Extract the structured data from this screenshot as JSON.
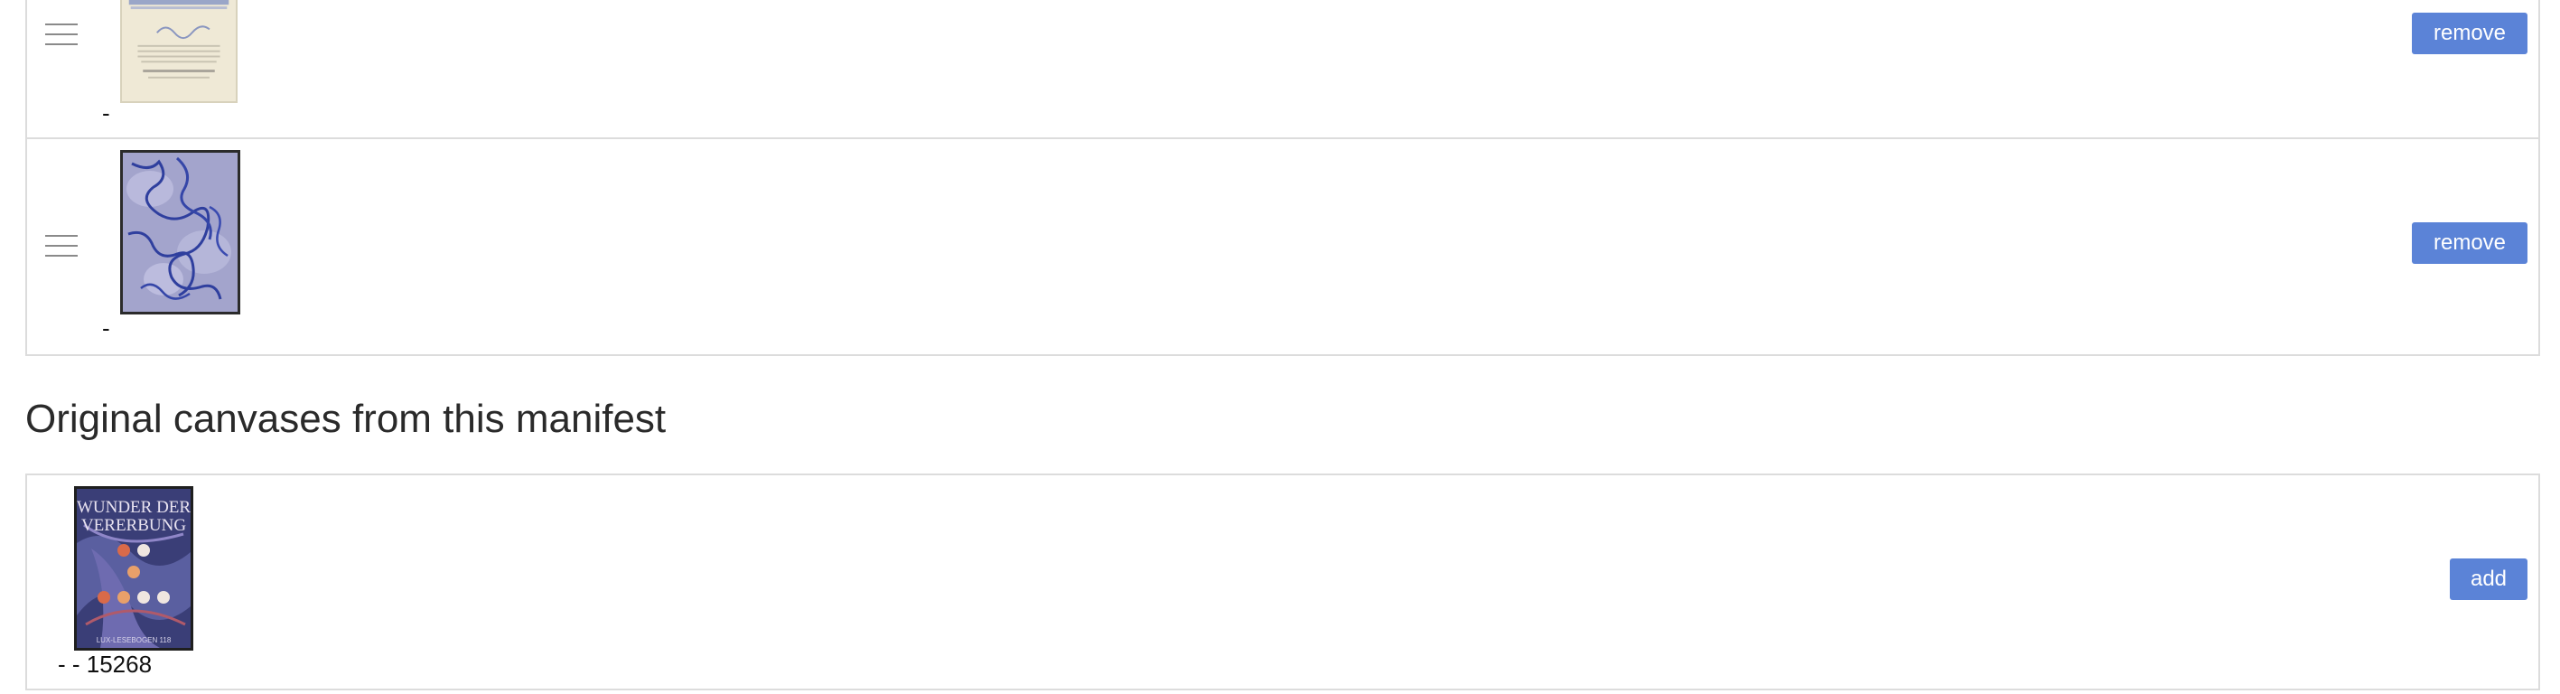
{
  "selected_canvases": {
    "items": [
      {
        "caption": "-",
        "action_label": "remove",
        "thumbnail": "letter-document-thumbnail"
      },
      {
        "caption": "-",
        "action_label": "remove",
        "thumbnail": "blue-pattern-thumbnail"
      }
    ]
  },
  "original_section": {
    "heading": "Original canvases from this manifest",
    "items": [
      {
        "caption": "- - 15268",
        "action_label": "add",
        "thumbnail": "book-cover-thumbnail",
        "cover_title_line1": "WUNDER DER",
        "cover_title_line2": "VERERBUNG",
        "cover_footer": "LUX-LESEBOGEN 118"
      }
    ]
  },
  "colors": {
    "button_background": "#5b83d7",
    "button_text": "#ffffff",
    "border": "#dcdcdc",
    "cover_background": "#3a3e77"
  }
}
